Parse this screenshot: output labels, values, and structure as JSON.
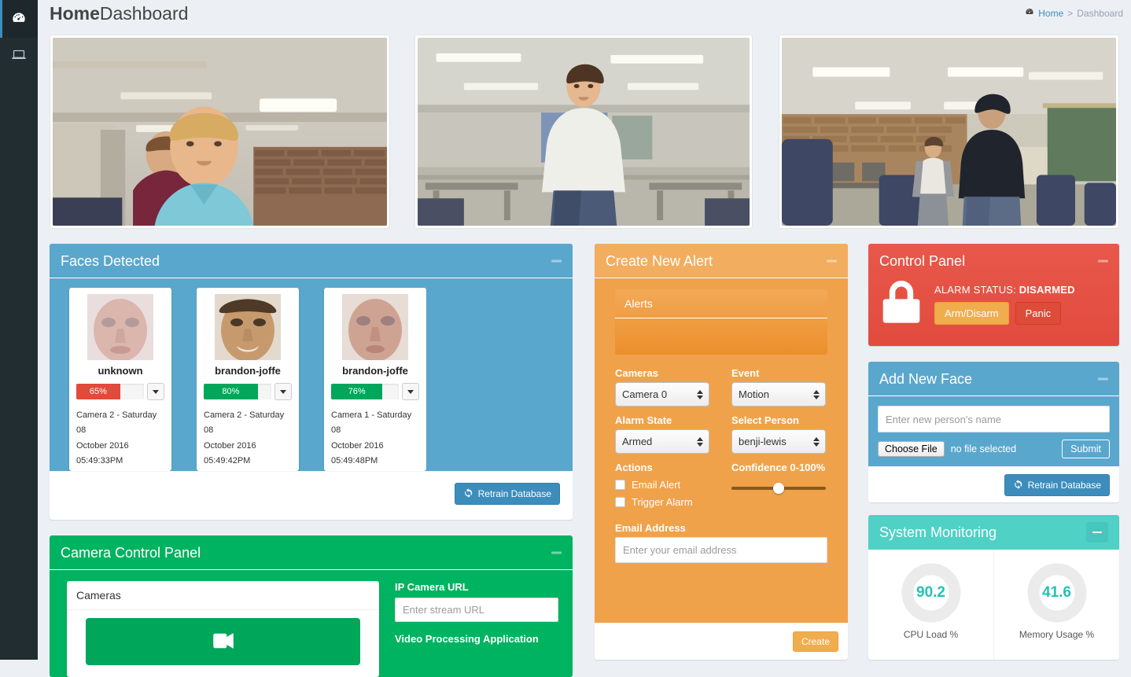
{
  "sidebar": {
    "items": [
      {
        "icon": "dashboard-icon",
        "active": true
      },
      {
        "icon": "laptop-icon",
        "active": false
      }
    ]
  },
  "header": {
    "title_bold": "Home",
    "title_rest": "Dashboard",
    "breadcrumb": {
      "home_icon": "dashboard-icon",
      "home": "Home",
      "separator": ">",
      "current": "Dashboard"
    }
  },
  "feeds": [
    {
      "name": "camera-feed-0"
    },
    {
      "name": "camera-feed-1"
    },
    {
      "name": "camera-feed-2"
    }
  ],
  "faces_panel": {
    "title": "Faces Detected",
    "minimize_icon": "minus-icon",
    "retrain_label": "Retrain Database",
    "retrain_icon": "refresh-icon",
    "cards": [
      {
        "name": "unknown",
        "confidence_label": "65%",
        "confidence_value": 65,
        "bar_color": "#e04b3b",
        "meta_line1": "Camera 2 - Saturday 08",
        "meta_line2": "October 2016 05:49:33PM"
      },
      {
        "name": "brandon-joffe",
        "confidence_label": "80%",
        "confidence_value": 80,
        "bar_color": "#00a65a",
        "meta_line1": "Camera 2 - Saturday 08",
        "meta_line2": "October 2016 05:49:42PM"
      },
      {
        "name": "brandon-joffe",
        "confidence_label": "76%",
        "confidence_value": 76,
        "bar_color": "#00a65a",
        "meta_line1": "Camera 1 - Saturday 08",
        "meta_line2": "October 2016 05:49:48PM"
      }
    ]
  },
  "camera_control_panel": {
    "title": "Camera Control Panel",
    "minimize_icon": "minus-icon",
    "list_header": "Cameras",
    "add_camera_icon": "video-camera-icon",
    "ip_url_label": "IP Camera URL",
    "ip_url_placeholder": "Enter stream URL",
    "ip_url_value": "",
    "video_app_label": "Video Processing Application"
  },
  "alert_panel": {
    "title": "Create New Alert",
    "minimize_icon": "minus-icon",
    "alerts_header": "Alerts",
    "cameras_label": "Cameras",
    "cameras_value": "Camera 0",
    "event_label": "Event",
    "event_value": "Motion",
    "alarm_state_label": "Alarm State",
    "alarm_state_value": "Armed",
    "select_person_label": "Select Person",
    "select_person_value": "benji-lewis",
    "actions_label": "Actions",
    "email_alert_label": "Email Alert",
    "trigger_alarm_label": "Trigger Alarm",
    "confidence_label": "Confidence 0-100%",
    "confidence_value": 50,
    "email_address_label": "Email Address",
    "email_placeholder": "Enter your email address",
    "email_value": "",
    "create_label": "Create"
  },
  "control_panel": {
    "title": "Control Panel",
    "minimize_icon": "minus-icon",
    "lock_icon": "lock-icon",
    "status_prefix": "ALARM STATUS:",
    "status_value": "DISARMED",
    "arm_label": "Arm/Disarm",
    "panic_label": "Panic"
  },
  "add_face_panel": {
    "title": "Add New Face",
    "minimize_icon": "minus-icon",
    "name_placeholder": "Enter new person's name",
    "name_value": "",
    "choose_file_label": "Choose File",
    "file_status": "no file selected",
    "submit_label": "Submit",
    "retrain_label": "Retrain Database",
    "retrain_icon": "refresh-icon"
  },
  "system_monitoring": {
    "title": "System Monitoring",
    "minimize_icon": "minus-icon",
    "gauges": [
      {
        "value": "90.2",
        "percent": 90.2,
        "label": "CPU Load %"
      },
      {
        "value": "41.6",
        "percent": 41.6,
        "label": "Memory Usage %"
      }
    ]
  },
  "colors": {
    "sidebar": "#222d32",
    "body": "#ecf0f5",
    "info": "#5aa7cd",
    "success": "#00b360",
    "warning": "#f0a24a",
    "danger": "#e14b3d",
    "teal": "#4fd1c5",
    "accent": "#3c8dbc"
  }
}
